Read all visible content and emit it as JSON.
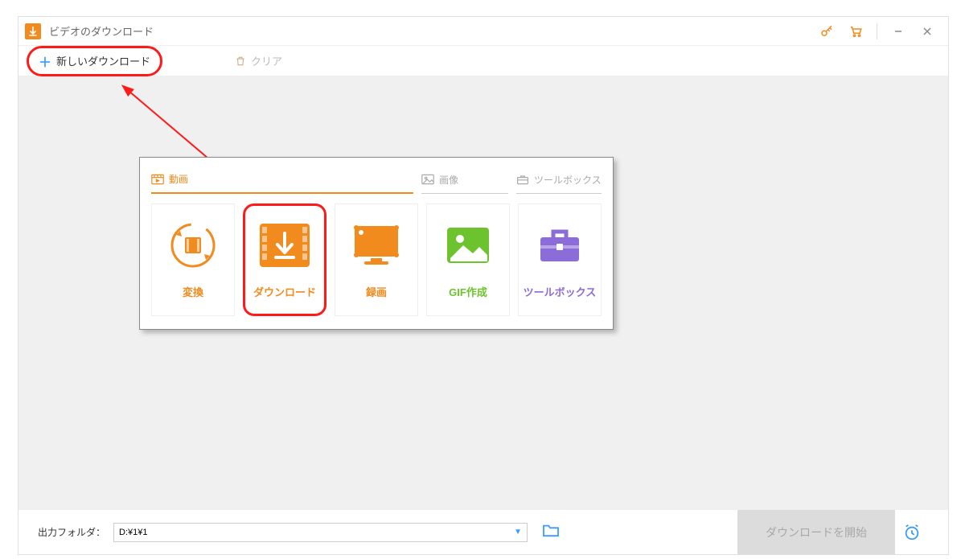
{
  "title": "ビデオのダウンロード",
  "toolbar": {
    "newDownload": "新しいダウンロード",
    "clear": "クリア"
  },
  "panel": {
    "tabs": {
      "video": "動画",
      "image": "画像",
      "toolbox": "ツールボックス"
    },
    "cards": {
      "convert": "変換",
      "download": "ダウンロード",
      "record": "録画",
      "gif": "GIF作成",
      "toolbox": "ツールボックス"
    }
  },
  "footer": {
    "outputLabel": "出力フォルダ：",
    "path": "D:¥1¥1",
    "startButton": "ダウンロードを開始"
  }
}
